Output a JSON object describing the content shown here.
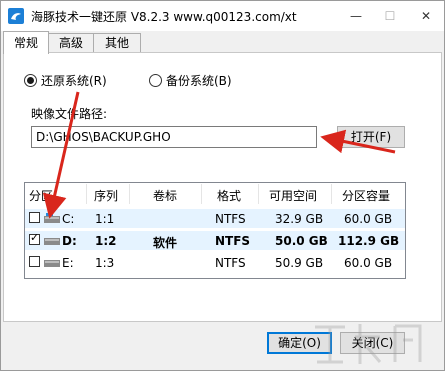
{
  "window": {
    "title": "海豚技术一键还原 V8.2.3 www.q00123.com/xt",
    "minimize": "—",
    "maximize": "☐",
    "close": "✕"
  },
  "tabs": [
    "常规",
    "高级",
    "其他"
  ],
  "mode": {
    "restore_label": "还原系统(R)",
    "backup_label": "备份系统(B)",
    "selected": "restore"
  },
  "image_path": {
    "label": "映像文件路径:",
    "value": "D:\\GHOS\\BACKUP.GHO",
    "open_button": "打开(F)"
  },
  "partition_table": {
    "headers": [
      "分区",
      "序列",
      "卷标",
      "格式",
      "可用空间",
      "分区容量"
    ],
    "rows": [
      {
        "checked": false,
        "drive": "C:",
        "seq": "1:1",
        "label": "",
        "format": "NTFS",
        "free": "32.9 GB",
        "size": "60.0 GB",
        "selected": true,
        "bold": false,
        "icon": "windows-drive-icon"
      },
      {
        "checked": true,
        "drive": "D:",
        "seq": "1:2",
        "label": "软件",
        "format": "NTFS",
        "free": "50.0 GB",
        "size": "112.9 GB",
        "selected": true,
        "bold": true,
        "icon": "drive-icon"
      },
      {
        "checked": false,
        "drive": "E:",
        "seq": "1:3",
        "label": "",
        "format": "NTFS",
        "free": "50.9 GB",
        "size": "60.0 GB",
        "selected": false,
        "bold": false,
        "icon": "drive-icon"
      }
    ]
  },
  "footer": {
    "ok_button": "确定(O)",
    "close_button": "关闭(C)"
  },
  "colors": {
    "selection": "#e5f3ff",
    "accent": "#0078d7",
    "annotation_arrow": "#d9261c"
  }
}
